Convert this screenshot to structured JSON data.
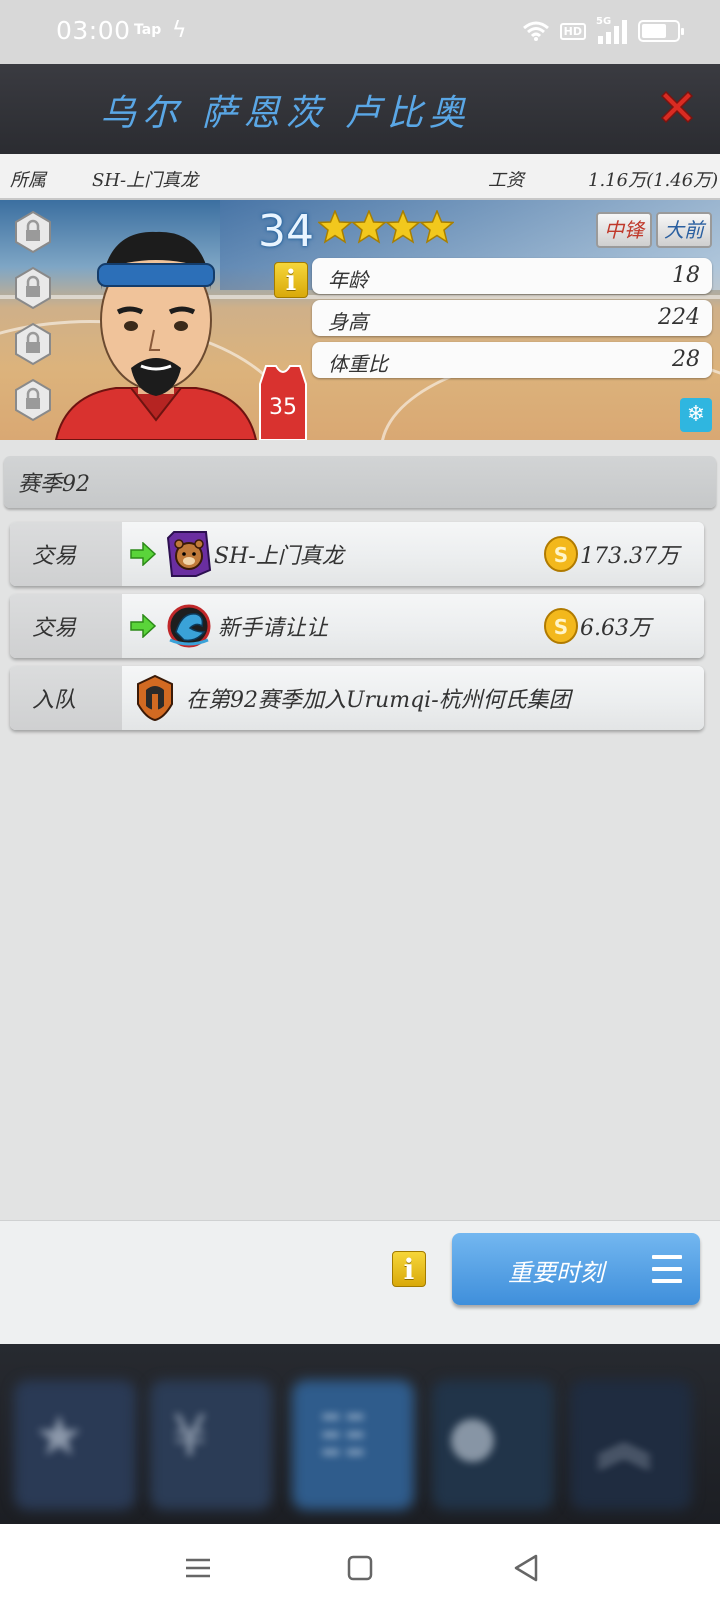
{
  "status_bar": {
    "time": "03:00",
    "tap_label": "Tap",
    "hd_label": "HD",
    "network_label": "5G"
  },
  "header": {
    "player_name": "乌尔 萨恩茨 卢比奥",
    "close_icon": "close-x-icon"
  },
  "info_bar": {
    "team_label": "所属",
    "team_value": "SH-上门真龙",
    "salary_label": "工资",
    "salary_value": "1.16万(1.46万)"
  },
  "player": {
    "rating": "34",
    "stars": 4,
    "jersey_number": "35",
    "tags": [
      "中锋",
      "大前"
    ],
    "stats": [
      {
        "label": "年龄",
        "value": "18"
      },
      {
        "label": "身高",
        "value": "224"
      },
      {
        "label": "体重比",
        "value": "28"
      }
    ],
    "colors": {
      "jersey": "#d9322f",
      "headband": "#2c6fb8",
      "stars": "#f2c81d"
    }
  },
  "history": {
    "season_label": "赛季92",
    "events": [
      {
        "type": "交易",
        "team": "SH-上门真龙",
        "fee": "173.37万",
        "logo_icon": "bear-logo-icon"
      },
      {
        "type": "交易",
        "team": "新手请让让",
        "fee": "6.63万",
        "logo_icon": "dragon-logo-icon"
      },
      {
        "type": "入队",
        "text": "在第92赛季加入Urumqi-杭州何氏集团",
        "logo_icon": "spartan-logo-icon"
      }
    ]
  },
  "footer": {
    "moments_button": "重要时刻"
  }
}
